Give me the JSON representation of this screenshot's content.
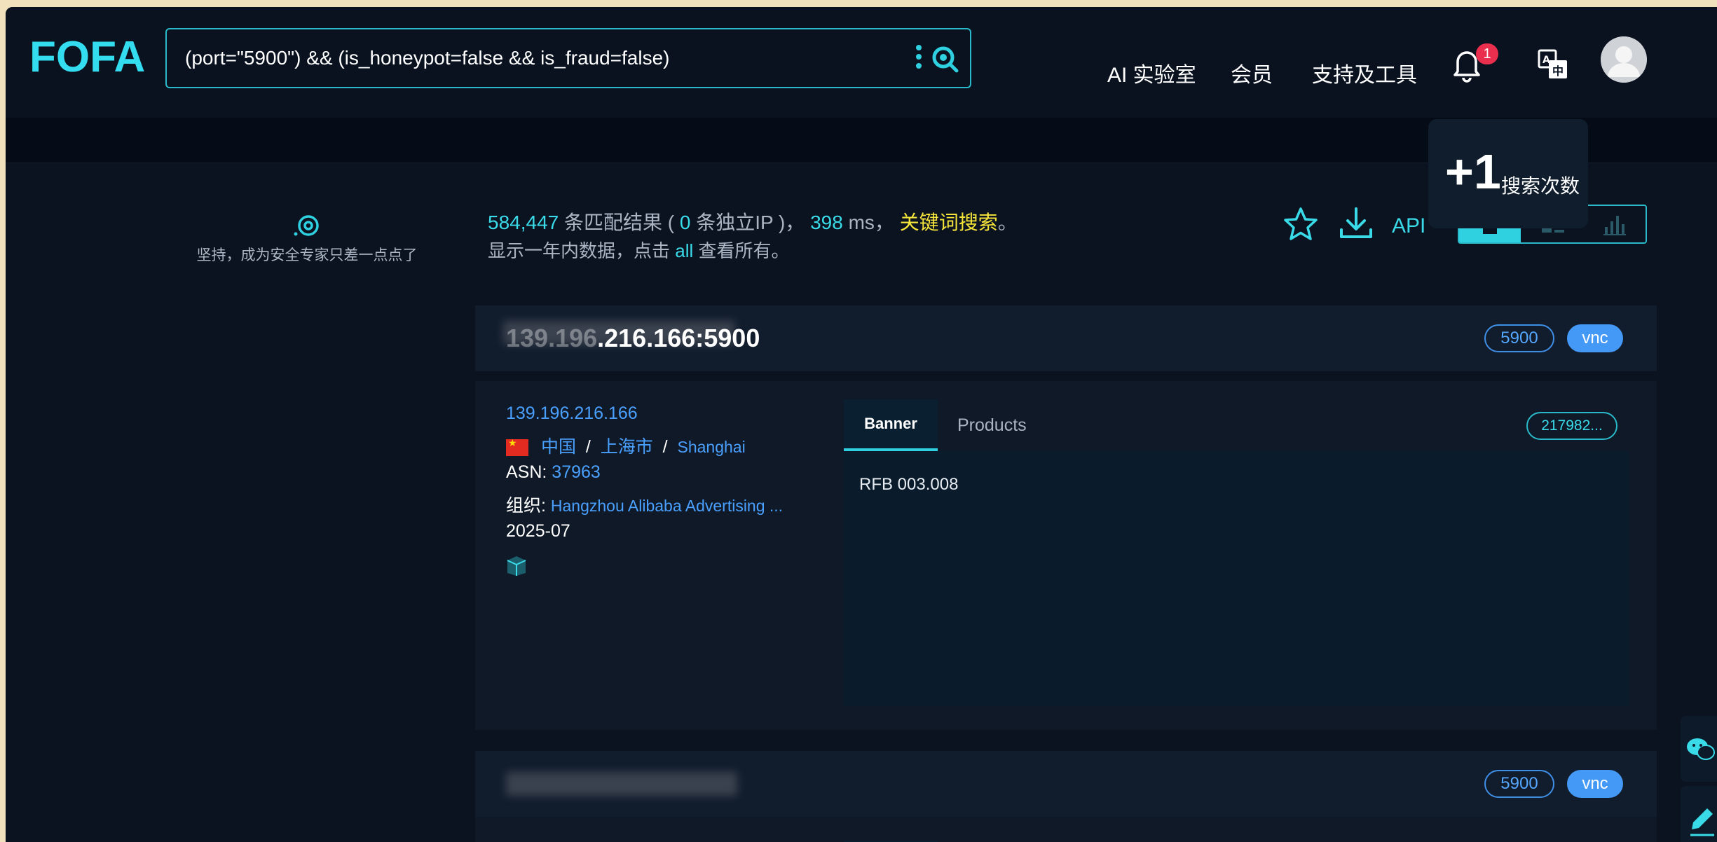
{
  "app": {
    "logo": "FOFA"
  },
  "search": {
    "query": "(port=\"5900\") && (is_honeypot=false && is_fraud=false)"
  },
  "nav": {
    "items": [
      "AI 实验室",
      "会员",
      "支持及工具"
    ],
    "notification_count": "1"
  },
  "popup": {
    "big": "+1",
    "small": "搜索次数"
  },
  "sidebar": {
    "tip": "坚持，成为安全专家只差一点点了"
  },
  "summary": {
    "count": "584,447",
    "matches_label": " 条匹配结果 ( ",
    "unique_ip": "0",
    "unique_ip_label": " 条独立IP )， ",
    "ms_value": "398",
    "ms_label": " ms， ",
    "keyword_search": "关键词搜索",
    "period": "。",
    "line2_prefix": "显示一年内数据，点击 ",
    "all_link": "all",
    "line2_suffix": " 查看所有。"
  },
  "toolbar": {
    "api_label": "API"
  },
  "results": [
    {
      "title_visible": ".216.166:5900",
      "title_prefix_masked": "139.196",
      "tags": [
        "5900",
        "vnc"
      ],
      "ip": "139.196.216.166",
      "country": "中国",
      "region": "上海市",
      "city": "Shanghai",
      "asn_label": "ASN: ",
      "asn": "37963",
      "org_label": "组织: ",
      "org": "Hangzhou Alibaba Advertising ...",
      "date": "2025-07",
      "tab_banner": "Banner",
      "tab_products": "Products",
      "hash": "217982...",
      "banner_text": "RFB 003.008"
    },
    {
      "tags": [
        "5900",
        "vnc"
      ]
    }
  ],
  "colors": {
    "accent": "#3adbe9",
    "background": "#0b1321",
    "link": "#4aa0ff",
    "highlight": "#f5e53a",
    "tag": "#4499f6",
    "badge": "#ea2e4d"
  }
}
